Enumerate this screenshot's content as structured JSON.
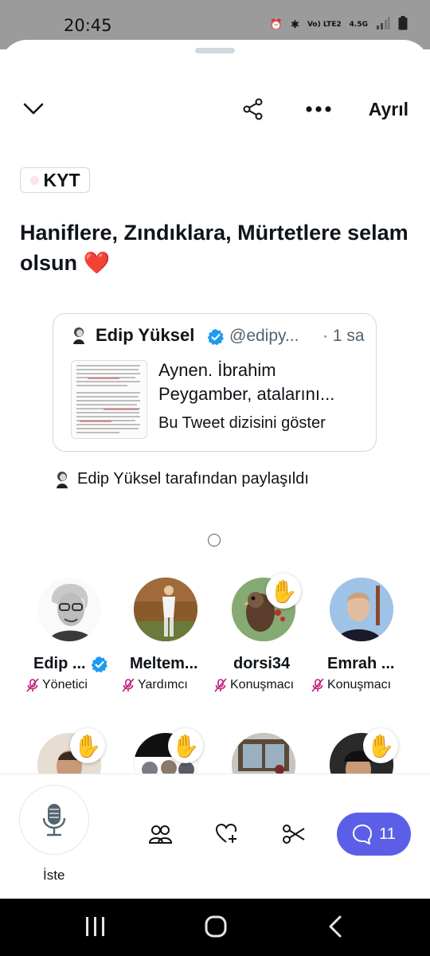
{
  "status_bar": {
    "time": "20:45",
    "network": "Vo) LTE2",
    "signal_type": "4.5G"
  },
  "header": {
    "leave_label": "Ayrıl"
  },
  "space": {
    "badge": "KYT",
    "title": "Haniflere, Zındıklara, Mürtetlere selam olsun",
    "title_emoji": "❤️"
  },
  "tweet": {
    "name": "Edip Yüksel",
    "handle": "@edipy...",
    "time": "· 1 sa",
    "text": "Aynen. İbrahim Peygamber, atalarını...",
    "thread_link": "Bu Tweet dizisini göster"
  },
  "shared_by": "Edip Yüksel tarafından paylaşıldı",
  "participants": [
    {
      "name": "Edip ...",
      "role": "Yönetici",
      "verified": true,
      "hand_raised": false
    },
    {
      "name": "Meltem...",
      "role": "Yardımcı",
      "verified": false,
      "hand_raised": false
    },
    {
      "name": "dorsi34",
      "role": "Konuşmacı",
      "verified": false,
      "hand_raised": true
    },
    {
      "name": "Emrah ...",
      "role": "Konuşmacı",
      "verified": false,
      "hand_raised": false
    }
  ],
  "participants_row2_hands": [
    true,
    true,
    false,
    true
  ],
  "bottom_bar": {
    "mic_label": "İste",
    "comment_count": "11"
  },
  "icons": {
    "collapse": "chevron-down-icon",
    "share": "share-icon",
    "more": "more-icon",
    "mic": "microphone-icon",
    "people": "people-icon",
    "heart": "heart-plus-icon",
    "clip": "scissors-icon",
    "comment": "comment-icon",
    "hand": "raised-hand-icon"
  },
  "colors": {
    "accent": "#5b5fe8",
    "verified": "#1d9bf0",
    "muted_mic": "#c2187a",
    "heart": "#e0245e"
  }
}
